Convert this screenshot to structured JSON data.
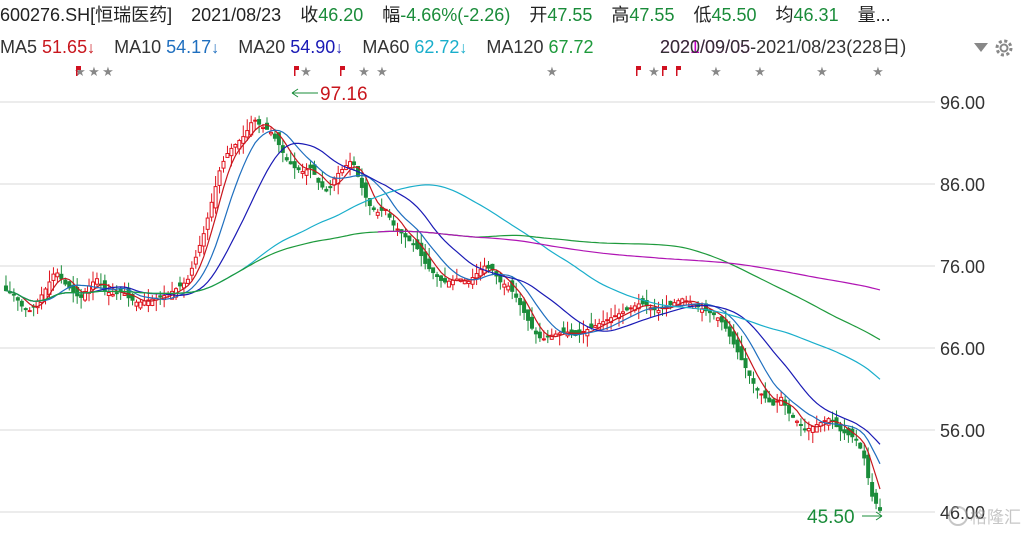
{
  "header": {
    "symbol": "600276.SH[恒瑞医药]",
    "date": "2021/08/23",
    "close_label": "收",
    "close": "46.20",
    "change_label": "幅",
    "change": "-4.66%(-2.26)",
    "open_label": "开",
    "open": "47.55",
    "high_label": "高",
    "high": "47.55",
    "low_label": "低",
    "low": "45.50",
    "avg_label": "均",
    "avg": "46.31",
    "vol_label": "量..."
  },
  "ma_row": {
    "items": [
      {
        "label": "MA5",
        "value": "51.65",
        "arrow": "↓",
        "color": "#c8161d"
      },
      {
        "label": "MA10",
        "value": "54.17",
        "arrow": "↓",
        "color": "#1f6fbf"
      },
      {
        "label": "MA20",
        "value": "54.90",
        "arrow": "↓",
        "color": "#1a1ab5"
      },
      {
        "label": "MA60",
        "value": "62.72",
        "arrow": "↓",
        "color": "#19aecb"
      },
      {
        "label": "MA120",
        "value": "67.72",
        "arrow": "",
        "color": "#1e9a3c"
      }
    ],
    "overlap_text": "2020/09/05-2021/08/23(228日)",
    "overlap_text_back": "2021/09/05",
    "overlap_color": "#c800c8",
    "range_color": "#333333"
  },
  "colors": {
    "up": "#e0141e",
    "down": "#1a8c3a",
    "ma5": "#c8161d",
    "ma10": "#1f6fbf",
    "ma20": "#1a1ab5",
    "ma60": "#19aecb",
    "ma120": "#1e9a3c",
    "ma250": "#b014b4",
    "grid": "#d8d8d8",
    "axis_text": "#333333"
  },
  "chart_data": {
    "type": "candlestick",
    "yticks": [
      "96.00",
      "86.00",
      "76.00",
      "66.00",
      "56.00",
      "46.00"
    ],
    "ylim": [
      44,
      101
    ],
    "annotations": {
      "high_label": "97.16",
      "low_label": "45.50"
    },
    "watermark": "格隆汇",
    "series_summary": {
      "last_close": 46.2,
      "last_low": 45.5,
      "period_high": 97.16
    },
    "close_path": [
      73,
      72.5,
      71,
      70.5,
      72,
      73.5,
      75.5,
      74,
      73,
      72,
      73.5,
      74.5,
      73,
      72.5,
      73,
      72,
      71.5,
      71.8,
      72,
      72.3,
      72.8,
      73.5,
      74.2,
      77,
      80,
      84,
      88,
      90,
      91,
      92,
      94,
      93,
      92.5,
      91,
      89,
      88,
      87.5,
      88,
      86,
      85,
      87,
      88,
      89,
      86,
      83.5,
      82.5,
      83,
      81,
      80,
      79,
      78,
      76,
      75,
      74,
      74.2,
      74.5,
      74,
      75,
      76,
      75.5,
      74,
      73.5,
      72,
      70,
      68,
      67,
      67.5,
      67.8,
      68,
      67.5,
      68,
      68.5,
      69,
      69.5,
      70,
      70.5,
      71,
      71.5,
      71,
      70.5,
      71,
      71.5,
      72,
      71.5,
      71,
      70.5,
      70,
      69,
      67,
      65,
      63,
      61,
      60,
      59,
      60,
      58,
      57,
      56,
      56.5,
      57,
      57.5,
      56,
      55.5,
      55,
      53,
      48,
      46.2
    ],
    "ma_lines_shown": [
      "MA5",
      "MA10",
      "MA20",
      "MA60",
      "MA120",
      "MA250"
    ]
  }
}
